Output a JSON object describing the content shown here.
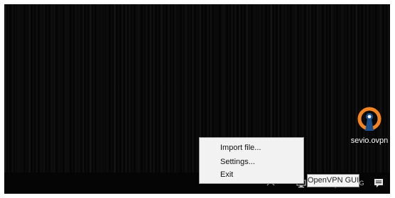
{
  "desktop": {
    "icon": {
      "name": "openvpn-config-icon",
      "label": "sevio.ovpn"
    }
  },
  "context_menu": {
    "items": [
      "Import file...",
      "Settings...",
      "Exit"
    ]
  },
  "tray": {
    "chevron_icon": "chevron-up-icon",
    "openvpn_icon": "openvpn-tray-icon",
    "speaker_icon": "speaker-icon",
    "language": "ENG",
    "notification_icon": "notification-icon"
  },
  "tooltip": {
    "text": "OpenVPN GUI"
  },
  "colors": {
    "desktop_bg": "#050505",
    "taskbar_bg": "#050505",
    "menu_bg": "#f2f2f2",
    "openvpn_orange": "#f48421",
    "openvpn_blue": "#1b4f8c"
  }
}
